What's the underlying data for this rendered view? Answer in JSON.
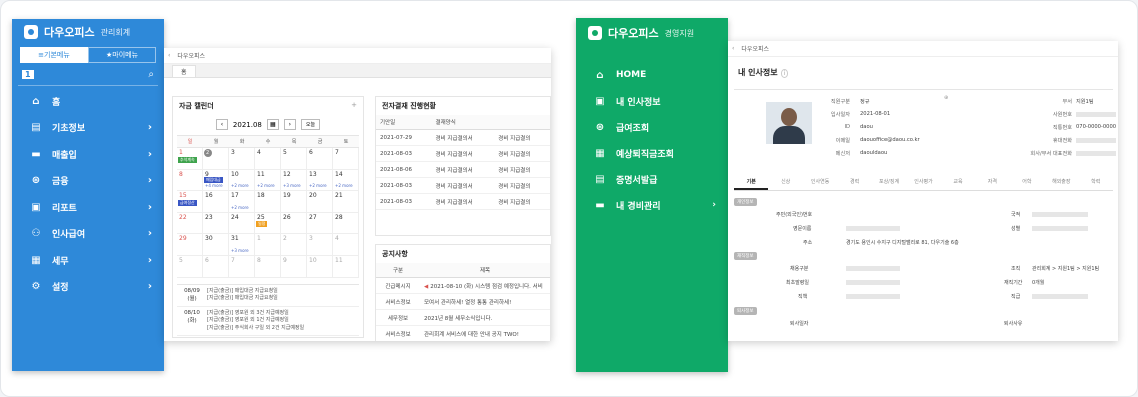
{
  "left_app": {
    "brand": "다우오피스",
    "brand_sub": "관리회계",
    "menu_tabs": [
      "기본메뉴",
      "마이메뉴"
    ],
    "toolbar_badge": "1",
    "nav": [
      {
        "label": "홈",
        "icon": "home-icon",
        "glyph": "⌂",
        "chevron": ""
      },
      {
        "label": "기초정보",
        "icon": "list-icon",
        "glyph": "▤",
        "chevron": "›"
      },
      {
        "label": "매출입",
        "icon": "card-icon",
        "glyph": "▬",
        "chevron": "›"
      },
      {
        "label": "금융",
        "icon": "coin-icon",
        "glyph": "⊛",
        "chevron": "›"
      },
      {
        "label": "리포트",
        "icon": "report-icon",
        "glyph": "▣",
        "chevron": "›"
      },
      {
        "label": "인사급여",
        "icon": "people-icon",
        "glyph": "⚇",
        "chevron": "›"
      },
      {
        "label": "세무",
        "icon": "calculator-icon",
        "glyph": "▦",
        "chevron": "›"
      },
      {
        "label": "설정",
        "icon": "gear-icon",
        "glyph": "⚙",
        "chevron": "›"
      }
    ],
    "topbar": "다우오피스",
    "tab": "홈",
    "calendar": {
      "title": "자금 캘린더",
      "month": "2021.08",
      "today_label": "오늘",
      "weekdays": [
        "일",
        "월",
        "화",
        "수",
        "목",
        "금",
        "토"
      ],
      "days": [
        {
          "d": "1",
          "ev": "추석계속"
        },
        {
          "d": "2",
          "circle": "",
          "more": ""
        },
        {
          "d": "3"
        },
        {
          "d": "4"
        },
        {
          "d": "5"
        },
        {
          "d": "6"
        },
        {
          "d": "7"
        },
        {
          "d": "8",
          "more": ""
        },
        {
          "d": "9",
          "ev": "매입대금",
          "more": "+4 more"
        },
        {
          "d": "10",
          "more": "+2 more"
        },
        {
          "d": "11",
          "more": "+2 more"
        },
        {
          "d": "12",
          "more": "+3 more"
        },
        {
          "d": "13",
          "more": "+2 more"
        },
        {
          "d": "14",
          "more": "+2 more"
        },
        {
          "d": "15",
          "ev": "급여정산"
        },
        {
          "d": "16"
        },
        {
          "d": "17",
          "more": "+2 more"
        },
        {
          "d": "18"
        },
        {
          "d": "19"
        },
        {
          "d": "20"
        },
        {
          "d": "21"
        },
        {
          "d": "22"
        },
        {
          "d": "23"
        },
        {
          "d": "24"
        },
        {
          "d": "25",
          "ev": "일정"
        },
        {
          "d": "26"
        },
        {
          "d": "27"
        },
        {
          "d": "28"
        },
        {
          "d": "29"
        },
        {
          "d": "30"
        },
        {
          "d": "31",
          "more": "+3 more"
        },
        {
          "d": "1",
          "grey": true
        },
        {
          "d": "2",
          "grey": true
        },
        {
          "d": "3",
          "grey": true
        },
        {
          "d": "4",
          "grey": true
        },
        {
          "d": "5",
          "grey": true
        },
        {
          "d": "6",
          "grey": true
        },
        {
          "d": "7",
          "grey": true
        },
        {
          "d": "8",
          "grey": true
        },
        {
          "d": "9",
          "grey": true
        },
        {
          "d": "10",
          "grey": true
        },
        {
          "d": "11",
          "grey": true
        }
      ],
      "agenda": [
        {
          "date": "08/09",
          "dow": "(월)",
          "items": [
            "[지급(출금)] 매입대금 지급요청일",
            "[지급(출금)] 매입대금 지급요청일"
          ]
        },
        {
          "date": "08/10",
          "dow": "(화)",
          "items": [
            "[지급(출금)] 영포원 외 3건 지급예정일",
            "[지급(출금)] 영포원 외 1건 지급예정일",
            "[지급(출금)] 주식회사 구일 외 2건 지급예정일"
          ]
        }
      ]
    },
    "approval": {
      "title": "전자결재 진행현황",
      "headers": [
        "기안일",
        "결재양식",
        ""
      ],
      "rows": [
        [
          "2021-07-29",
          "경비 지급결의서",
          "경비 지급결의"
        ],
        [
          "2021-08-03",
          "경비 지급결의서",
          "경비 지급결의"
        ],
        [
          "2021-08-06",
          "경비 지급결의서",
          "경비 지급결의"
        ],
        [
          "2021-08-03",
          "경비 지급결의서",
          "경비 지급결의"
        ],
        [
          "2021-08-03",
          "경비 지급결의서",
          "경비 지급결의"
        ]
      ]
    },
    "notice": {
      "title": "공지사항",
      "headers": [
        "구분",
        "제목"
      ],
      "rows": [
        [
          "긴급메시지",
          "2021-08-10 (화) 시스템 점검 예정입니다. 서비"
        ],
        [
          "서비스정보",
          "모여서 관리하세! 열정 통통 관리하세!"
        ],
        [
          "세무정보",
          "2021년 8월 세무소식입니다."
        ],
        [
          "서비스정보",
          "관리회계 서비스에 대한 안내 공지 TWO!"
        ],
        [
          "서비스정보",
          "관리회계 서비스에 대한 안내 공지 ONE!"
        ]
      ]
    }
  },
  "right_app": {
    "brand": "다우오피스",
    "brand_sub": "경영지원",
    "nav": [
      {
        "label": "HOME",
        "icon": "home-icon",
        "glyph": "⌂",
        "chevron": ""
      },
      {
        "label": "내 인사정보",
        "icon": "id-card-icon",
        "glyph": "▣",
        "chevron": ""
      },
      {
        "label": "급여조회",
        "icon": "coin-icon",
        "glyph": "⊛",
        "chevron": ""
      },
      {
        "label": "예상퇴직금조회",
        "icon": "calculator-icon",
        "glyph": "▦",
        "chevron": ""
      },
      {
        "label": "증명서발급",
        "icon": "document-icon",
        "glyph": "▤",
        "chevron": ""
      },
      {
        "label": "내 경비관리",
        "icon": "wallet-icon",
        "glyph": "▬",
        "chevron": "›"
      }
    ],
    "topbar": "다우오피스",
    "page_title": "내 인사정보",
    "profile": {
      "fields_left": [
        {
          "k": "직원구분",
          "v": "정규"
        },
        {
          "k": "입사일자",
          "v": "2021-08-01"
        },
        {
          "k": "ID",
          "v": "daou"
        },
        {
          "k": "이메일",
          "v": "daouoffice@daou.co.kr"
        },
        {
          "k": "메신저",
          "v": "daouldaou"
        }
      ],
      "fields_right": [
        {
          "k": "부서",
          "v": "지원1팀"
        },
        {
          "k": "사원번호",
          "v": ""
        },
        {
          "k": "직통번호",
          "v": "070-0000-0000"
        },
        {
          "k": "휴대전화",
          "v": ""
        },
        {
          "k": "회사/부서 대표전화",
          "v": ""
        }
      ]
    },
    "tabs": [
      "기본",
      "신상",
      "인사연동",
      "경력",
      "포상/징계",
      "인사평가",
      "교육",
      "자격",
      "어학",
      "해외출장",
      "학력"
    ],
    "sections": [
      "개인정보",
      "재직정보",
      "퇴사정보"
    ],
    "detail_labels": {
      "id_no": "주민(외국인)번호",
      "english_name": "영문이름",
      "address": "주소",
      "address_value": "경기도 용인시 수지구 디지털밸리로 81, 다우기술 6층",
      "nationality": "국적",
      "gender": "성별",
      "employ_type": "채용구분",
      "org": "조직",
      "org_value": "관리회계 > 지원1팀 > 지원1팀",
      "first_join": "최초발령일",
      "tenure": "재직기간",
      "tenure_value": "0개월",
      "position": "직급",
      "duty": "직책",
      "retire_date": "퇴사일자",
      "retire_reason": "퇴사사유"
    }
  }
}
